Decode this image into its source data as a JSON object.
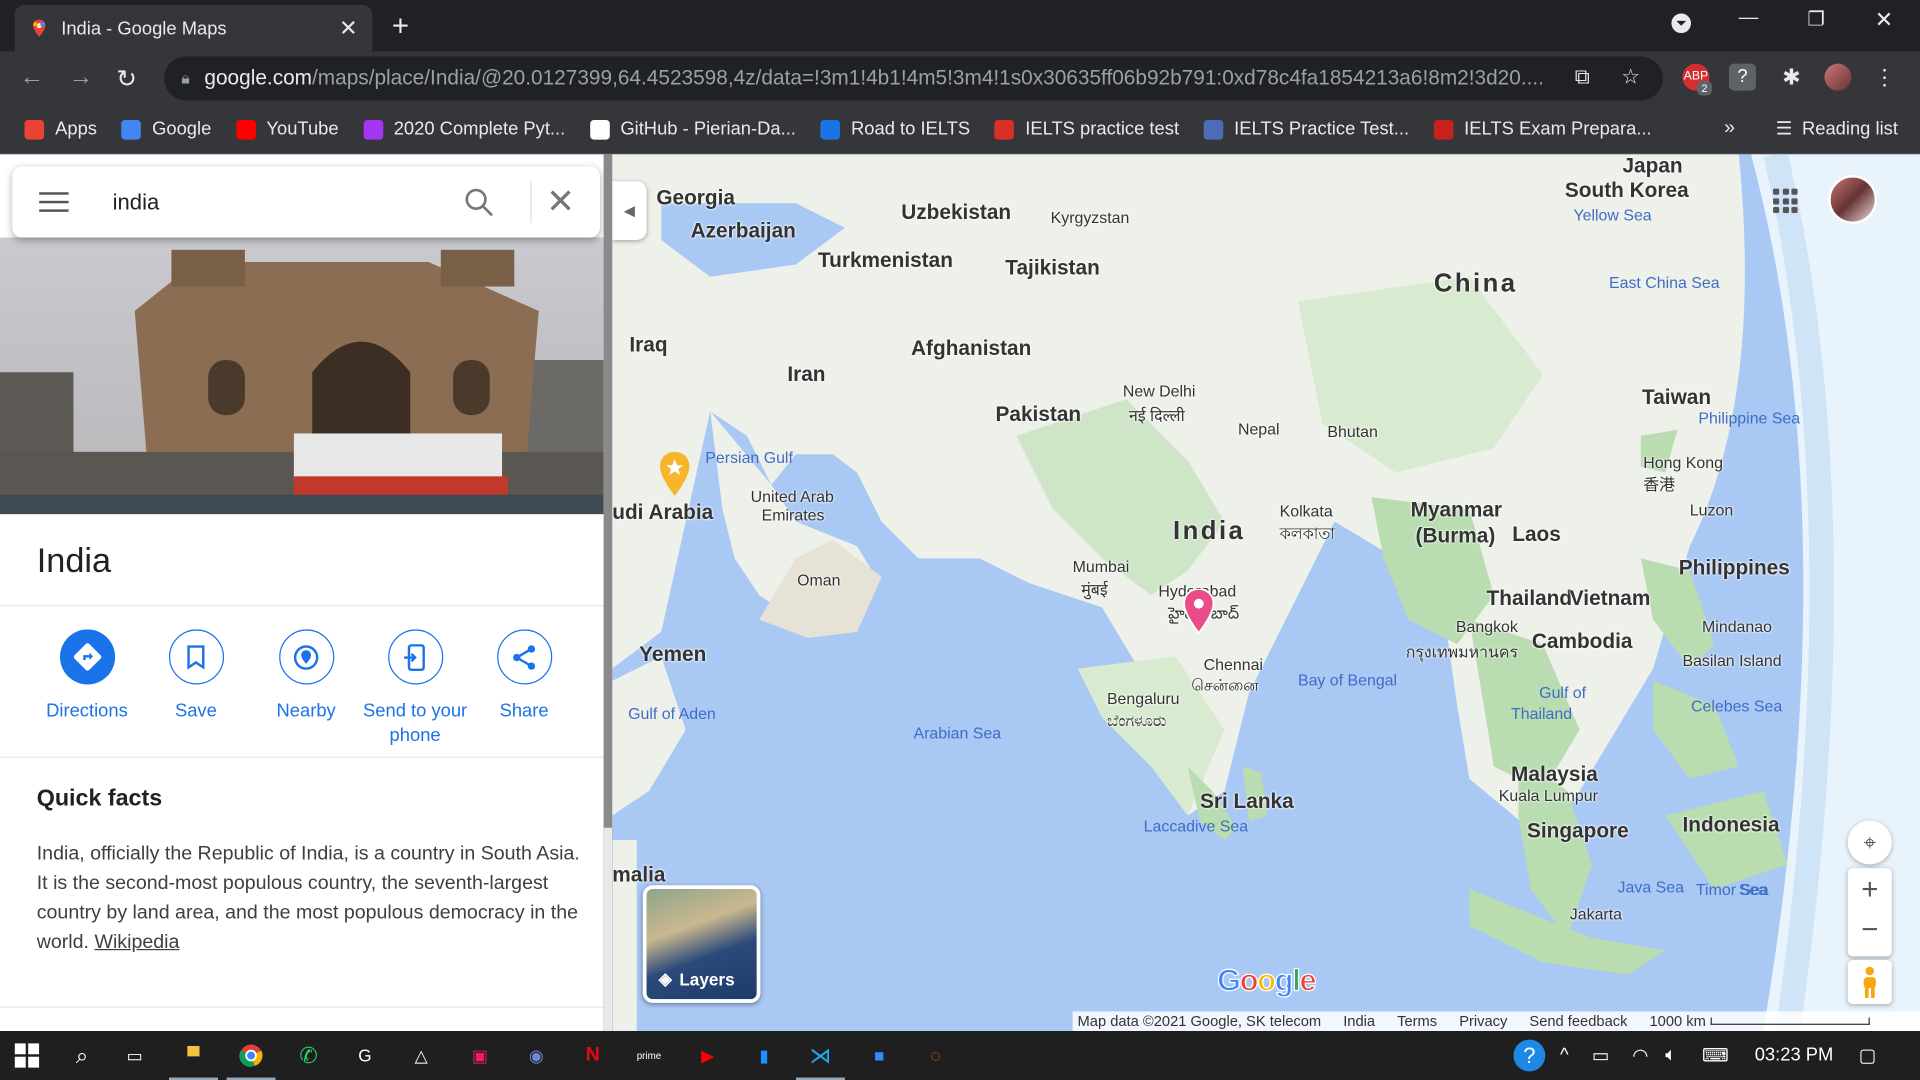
{
  "browser": {
    "tab_title": "India - Google Maps",
    "url_host": "google.com",
    "url_path": "/maps/place/India/@20.0127399,64.4523598,4z/data=!3m1!4b1!4m5!3m4!1s0x30635ff06b92b791:0xd78c4fa1854213a6!8m2!3d20....",
    "bookmarks": [
      {
        "label": "Apps",
        "color": "#ea4335"
      },
      {
        "label": "Google",
        "color": "#4285f4"
      },
      {
        "label": "YouTube",
        "color": "#ff0000"
      },
      {
        "label": "2020 Complete Pyt...",
        "color": "#a435f0"
      },
      {
        "label": "GitHub - Pierian-Da...",
        "color": "#ffffff"
      },
      {
        "label": "Road to IELTS",
        "color": "#1a73e8"
      },
      {
        "label": "IELTS practice test",
        "color": "#d93025"
      },
      {
        "label": "IELTS Practice Test...",
        "color": "#4b6cb7"
      },
      {
        "label": "IELTS Exam Prepara...",
        "color": "#c5221f"
      }
    ],
    "overflow": "»",
    "reading_list": "Reading list",
    "ext_badge": "ABP",
    "ext_count": "2"
  },
  "search": {
    "value": "india"
  },
  "place": {
    "title": "India",
    "actions": [
      {
        "label": "Directions",
        "icon": "directions-icon"
      },
      {
        "label": "Save",
        "icon": "bookmark-icon"
      },
      {
        "label": "Nearby",
        "icon": "nearby-icon"
      },
      {
        "label": "Send to your phone",
        "icon": "send-to-phone-icon"
      },
      {
        "label": "Share",
        "icon": "share-icon"
      }
    ],
    "quick_facts_title": "Quick facts",
    "quick_facts_text": "India, officially the Republic of India, is a country in South Asia. It is the second-most populous country, the seventh-largest country by land area, and the most populous democracy in the world.",
    "wiki_link": "Wikipedia"
  },
  "map": {
    "labels": [
      {
        "t": "Georgia",
        "c": "country"
      },
      {
        "t": "Azerbaijan",
        "c": "country"
      },
      {
        "t": "Uzbekistan",
        "c": "country"
      },
      {
        "t": "Kyrgyzstan",
        "c": "city"
      },
      {
        "t": "Turkmenistan",
        "c": "country"
      },
      {
        "t": "Tajikistan",
        "c": "country"
      },
      {
        "t": "China",
        "c": "big"
      },
      {
        "t": "South Korea",
        "c": "country"
      },
      {
        "t": "Japan",
        "c": "country"
      },
      {
        "t": "Yellow Sea",
        "c": "sea"
      },
      {
        "t": "East China Sea",
        "c": "sea"
      },
      {
        "t": "Iraq",
        "c": "country"
      },
      {
        "t": "Iran",
        "c": "country"
      },
      {
        "t": "Afghanistan",
        "c": "country"
      },
      {
        "t": "Pakistan",
        "c": "country"
      },
      {
        "t": "New Delhi",
        "c": "city"
      },
      {
        "t": "नई दिल्ली",
        "c": "city"
      },
      {
        "t": "Nepal",
        "c": "city"
      },
      {
        "t": "Bhutan",
        "c": "city"
      },
      {
        "t": "Taiwan",
        "c": "country"
      },
      {
        "t": "Philippine Sea",
        "c": "sea"
      },
      {
        "t": "Persian Gulf",
        "c": "sea"
      },
      {
        "t": "United Arab",
        "c": "city"
      },
      {
        "t": "Emirates",
        "c": "city"
      },
      {
        "t": "udi Arabia",
        "c": "country"
      },
      {
        "t": "Kolkata",
        "c": "city"
      },
      {
        "t": "কলকাতা",
        "c": "city"
      },
      {
        "t": "India",
        "c": "big"
      },
      {
        "t": "Myanmar",
        "c": "country"
      },
      {
        "t": "(Burma)",
        "c": "country"
      },
      {
        "t": "Laos",
        "c": "country"
      },
      {
        "t": "Hong Kong",
        "c": "city"
      },
      {
        "t": "香港",
        "c": "city"
      },
      {
        "t": "Luzon",
        "c": "city"
      },
      {
        "t": "Philippines",
        "c": "country"
      },
      {
        "t": "Oman",
        "c": "city"
      },
      {
        "t": "Mumbai",
        "c": "city"
      },
      {
        "t": "मुंबई",
        "c": "city"
      },
      {
        "t": "Hyderabad",
        "c": "city"
      },
      {
        "t": "హైదరాబాద్",
        "c": "city"
      },
      {
        "t": "Thailand",
        "c": "country"
      },
      {
        "t": "Vietnam",
        "c": "country"
      },
      {
        "t": "Bangkok",
        "c": "city"
      },
      {
        "t": "กรุงเทพมหานคร",
        "c": "city"
      },
      {
        "t": "Cambodia",
        "c": "country"
      },
      {
        "t": "Mindanao",
        "c": "city"
      },
      {
        "t": "Yemen",
        "c": "country"
      },
      {
        "t": "Chennai",
        "c": "city"
      },
      {
        "t": "சென்னை",
        "c": "city"
      },
      {
        "t": "Bay of Bengal",
        "c": "sea"
      },
      {
        "t": "Basilan Island",
        "c": "city"
      },
      {
        "t": "Gulf of Aden",
        "c": "sea"
      },
      {
        "t": "Bengaluru",
        "c": "city"
      },
      {
        "t": "ಬೆಂಗಳೂರು",
        "c": "city"
      },
      {
        "t": "Gulf of",
        "c": "sea"
      },
      {
        "t": "Thailand",
        "c": "sea"
      },
      {
        "t": "Celebes Sea",
        "c": "sea"
      },
      {
        "t": "Arabian Sea",
        "c": "sea"
      },
      {
        "t": "Malaysia",
        "c": "country"
      },
      {
        "t": "Kuala Lumpur",
        "c": "city"
      },
      {
        "t": "Sri Lanka",
        "c": "country"
      },
      {
        "t": "Singapore",
        "c": "country"
      },
      {
        "t": "Indonesia",
        "c": "country"
      },
      {
        "t": "Laccadive Sea",
        "c": "sea"
      },
      {
        "t": "malia",
        "c": "country"
      },
      {
        "t": "Java Sea",
        "c": "sea"
      },
      {
        "t": "Timor Sea",
        "c": "sea"
      },
      {
        "t": "Jakarta",
        "c": "city"
      },
      {
        "t": "Sea",
        "c": "sea"
      }
    ],
    "layers_label": "Layers",
    "google_logo": "Google",
    "attribution": [
      "Map data ©2021 Google, SK telecom",
      "India",
      "Terms",
      "Privacy",
      "Send feedback",
      "1000 km"
    ]
  },
  "taskbar": {
    "time": "03:23 PM"
  }
}
